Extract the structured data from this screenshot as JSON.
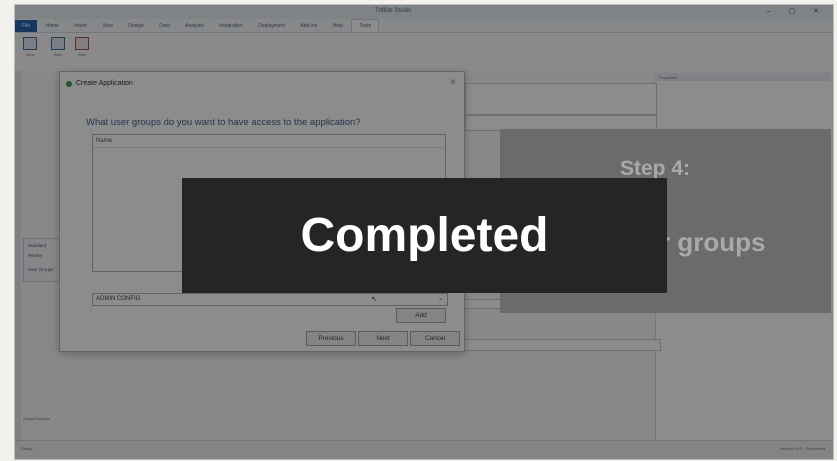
{
  "app": {
    "window_title": "Triffids Studio",
    "window_controls": "– ▢ ✕",
    "tabs": [
      "File",
      "Home",
      "Insert",
      "View",
      "Design",
      "Data",
      "Analysis",
      "Integration",
      "Deployment",
      "Add-ins",
      "Help",
      "Tools"
    ],
    "ribbon_buttons": [
      "Item",
      "Item",
      "Item"
    ],
    "pane_header": "Properties",
    "status_left": "Ready",
    "status_right": "Version 10.0 · Connected",
    "bottom_tab": "Output Results"
  },
  "dialog": {
    "title": "Create Application",
    "close": "×",
    "question": "What user groups do you want to have access to the application?",
    "grid_header": "Name",
    "combo_value": "ADMIN CONFIG",
    "combo_arrow": "⌄",
    "cursor": "↖",
    "buttons": {
      "add": "Add",
      "previous": "Previous",
      "next": "Next",
      "cancel": "Cancel"
    }
  },
  "sidebox": {
    "items": [
      "Standard",
      "Private",
      "User Groups"
    ]
  },
  "overlay": {
    "step_title": "Step 4:",
    "step_subtitle": "r groups",
    "banner": "Completed"
  }
}
